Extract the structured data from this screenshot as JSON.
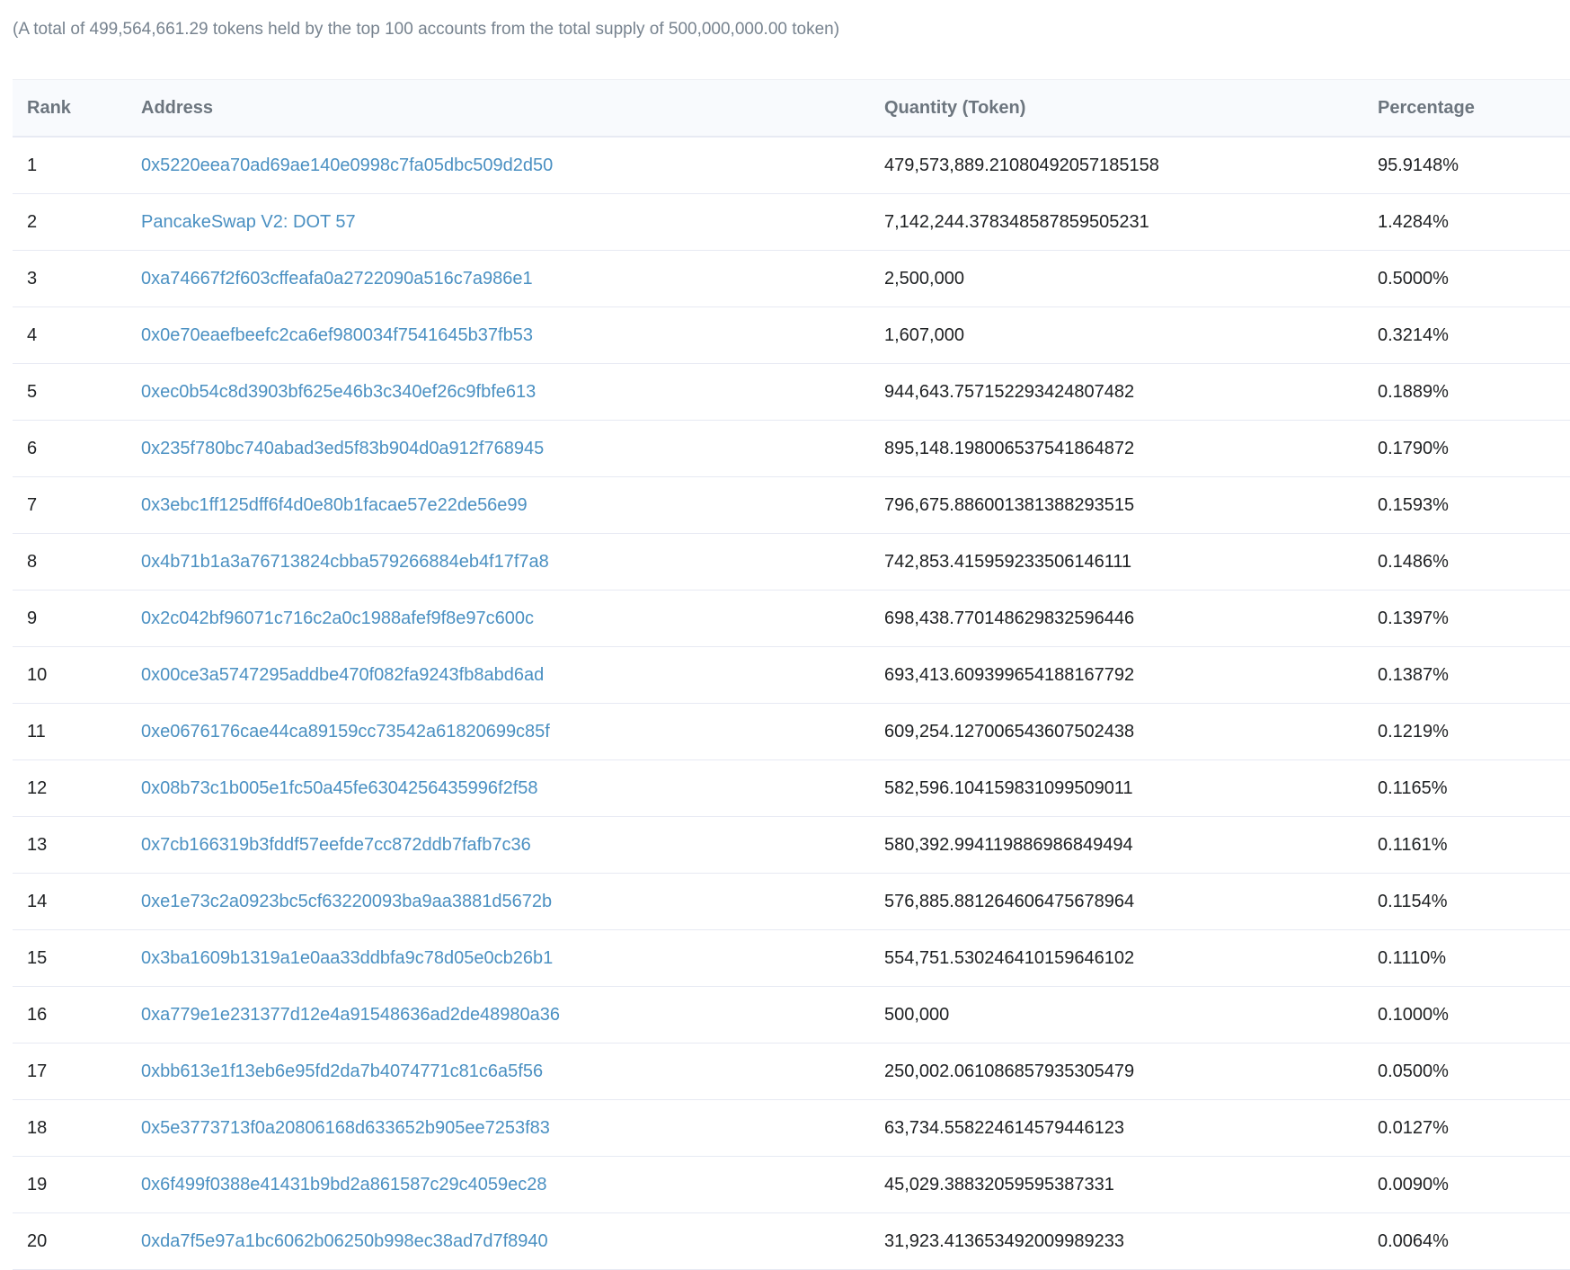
{
  "summary": "(A total of 499,564,661.29 tokens held by the top 100 accounts from the total supply of 500,000,000.00 token)",
  "table": {
    "headers": {
      "rank": "Rank",
      "address": "Address",
      "quantity": "Quantity (Token)",
      "percentage": "Percentage"
    },
    "rows": [
      {
        "rank": "1",
        "address": "0x5220eea70ad69ae140e0998c7fa05dbc509d2d50",
        "quantity": "479,573,889.21080492057185158",
        "percentage": "95.9148%"
      },
      {
        "rank": "2",
        "address": "PancakeSwap V2: DOT 57",
        "quantity": "7,142,244.378348587859505231",
        "percentage": "1.4284%"
      },
      {
        "rank": "3",
        "address": "0xa74667f2f603cffeafa0a2722090a516c7a986e1",
        "quantity": "2,500,000",
        "percentage": "0.5000%"
      },
      {
        "rank": "4",
        "address": "0x0e70eaefbeefc2ca6ef980034f7541645b37fb53",
        "quantity": "1,607,000",
        "percentage": "0.3214%"
      },
      {
        "rank": "5",
        "address": "0xec0b54c8d3903bf625e46b3c340ef26c9fbfe613",
        "quantity": "944,643.757152293424807482",
        "percentage": "0.1889%"
      },
      {
        "rank": "6",
        "address": "0x235f780bc740abad3ed5f83b904d0a912f768945",
        "quantity": "895,148.198006537541864872",
        "percentage": "0.1790%"
      },
      {
        "rank": "7",
        "address": "0x3ebc1ff125dff6f4d0e80b1facae57e22de56e99",
        "quantity": "796,675.886001381388293515",
        "percentage": "0.1593%"
      },
      {
        "rank": "8",
        "address": "0x4b71b1a3a76713824cbba579266884eb4f17f7a8",
        "quantity": "742,853.415959233506146111",
        "percentage": "0.1486%"
      },
      {
        "rank": "9",
        "address": "0x2c042bf96071c716c2a0c1988afef9f8e97c600c",
        "quantity": "698,438.770148629832596446",
        "percentage": "0.1397%"
      },
      {
        "rank": "10",
        "address": "0x00ce3a5747295addbe470f082fa9243fb8abd6ad",
        "quantity": "693,413.609399654188167792",
        "percentage": "0.1387%"
      },
      {
        "rank": "11",
        "address": "0xe0676176cae44ca89159cc73542a61820699c85f",
        "quantity": "609,254.127006543607502438",
        "percentage": "0.1219%"
      },
      {
        "rank": "12",
        "address": "0x08b73c1b005e1fc50a45fe6304256435996f2f58",
        "quantity": "582,596.104159831099509011",
        "percentage": "0.1165%"
      },
      {
        "rank": "13",
        "address": "0x7cb166319b3fddf57eefde7cc872ddb7fafb7c36",
        "quantity": "580,392.994119886986849494",
        "percentage": "0.1161%"
      },
      {
        "rank": "14",
        "address": "0xe1e73c2a0923bc5cf63220093ba9aa3881d5672b",
        "quantity": "576,885.881264606475678964",
        "percentage": "0.1154%"
      },
      {
        "rank": "15",
        "address": "0x3ba1609b1319a1e0aa33ddbfa9c78d05e0cb26b1",
        "quantity": "554,751.530246410159646102",
        "percentage": "0.1110%"
      },
      {
        "rank": "16",
        "address": "0xa779e1e231377d12e4a91548636ad2de48980a36",
        "quantity": "500,000",
        "percentage": "0.1000%"
      },
      {
        "rank": "17",
        "address": "0xbb613e1f13eb6e95fd2da7b4074771c81c6a5f56",
        "quantity": "250,002.061086857935305479",
        "percentage": "0.0500%"
      },
      {
        "rank": "18",
        "address": "0x5e3773713f0a20806168d633652b905ee7253f83",
        "quantity": "63,734.558224614579446123",
        "percentage": "0.0127%"
      },
      {
        "rank": "19",
        "address": "0x6f499f0388e41431b9bd2a861587c29c4059ec28",
        "quantity": "45,029.38832059595387331",
        "percentage": "0.0090%"
      },
      {
        "rank": "20",
        "address": "0xda7f5e97a1bc6062b06250b998ec38ad7d7f8940",
        "quantity": "31,923.413653492009989233",
        "percentage": "0.0064%"
      }
    ]
  },
  "colors": {
    "link": "#4a90c2",
    "header_bg": "#f8fafd",
    "muted_text": "#77838f"
  }
}
